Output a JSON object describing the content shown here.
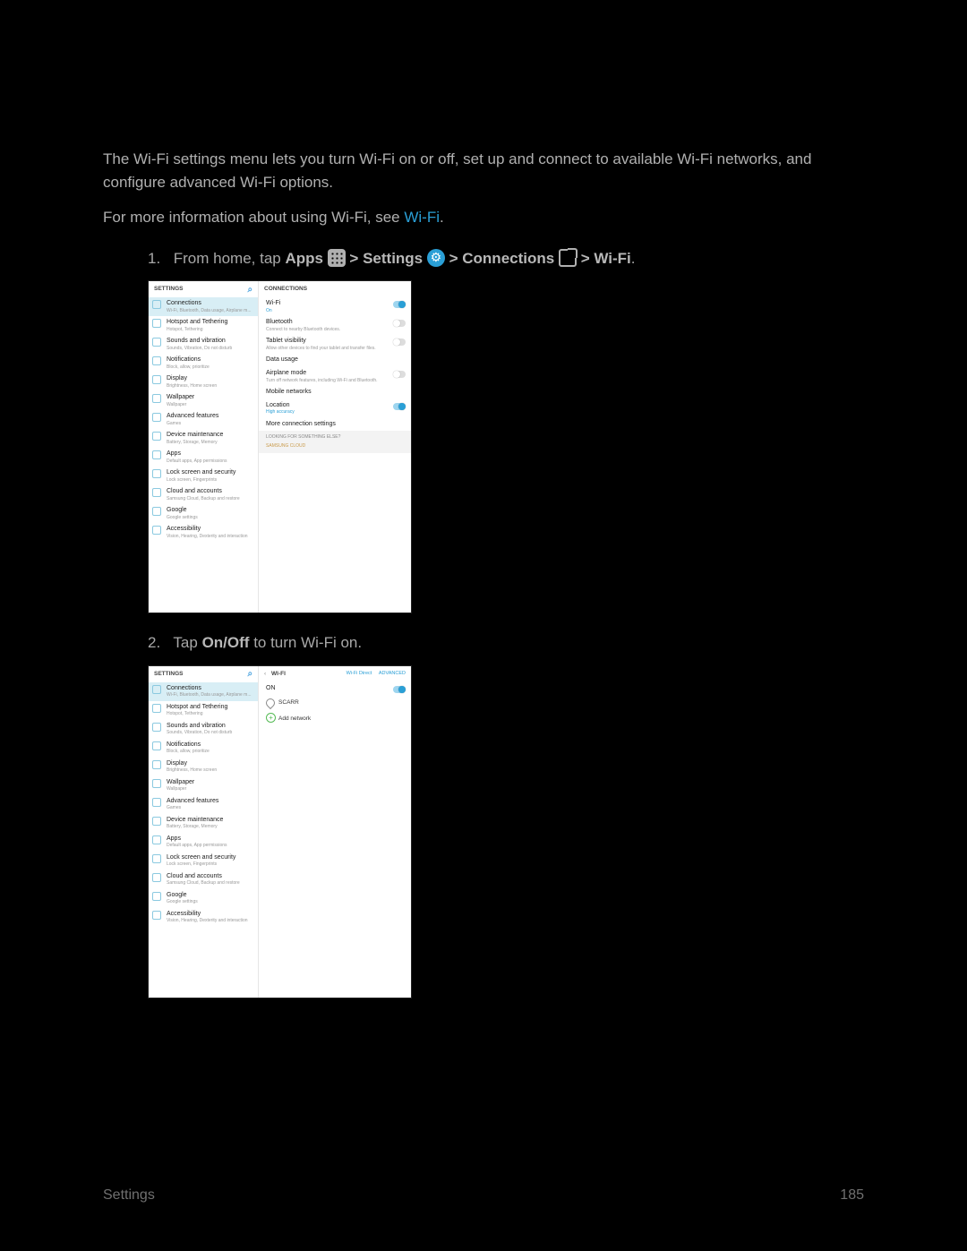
{
  "intro": "The Wi-Fi settings menu lets you turn Wi-Fi on or off, set up and connect to available Wi-Fi networks, and configure advanced Wi-Fi options.",
  "info_prefix": "For more information about using Wi-Fi, see ",
  "info_link": "Wi-Fi",
  "step1": {
    "num": "1.",
    "pre": "From home, tap ",
    "apps": "Apps",
    "gt1": " > ",
    "settings": "Settings",
    "gt2": " > ",
    "connections": "Connections",
    "gt3": " > ",
    "wifi": "Wi-Fi",
    "dot": "."
  },
  "step2": {
    "num": "2.",
    "pre": "Tap ",
    "onoff": "On/Off",
    "post": " to turn Wi-Fi on."
  },
  "mock": {
    "settings_hdr": "SETTINGS",
    "connections_hdr": "CONNECTIONS",
    "wifi_hdr": "WI-FI",
    "wifi_direct": "Wi-Fi Direct",
    "advanced": "ADVANCED",
    "on_label": "ON",
    "sidebar": [
      {
        "t": "Connections",
        "s": "Wi-Fi, Bluetooth, Data usage, Airplane m..."
      },
      {
        "t": "Hotspot and Tethering",
        "s": "Hotspot, Tethering"
      },
      {
        "t": "Sounds and vibration",
        "s": "Sounds, Vibration, Do not disturb"
      },
      {
        "t": "Notifications",
        "s": "Block, allow, prioritize"
      },
      {
        "t": "Display",
        "s": "Brightness, Home screen"
      },
      {
        "t": "Wallpaper",
        "s": "Wallpaper"
      },
      {
        "t": "Advanced features",
        "s": "Games"
      },
      {
        "t": "Device maintenance",
        "s": "Battery, Storage, Memory"
      },
      {
        "t": "Apps",
        "s": "Default apps, App permissions"
      },
      {
        "t": "Lock screen and security",
        "s": "Lock screen, Fingerprints"
      },
      {
        "t": "Cloud and accounts",
        "s": "Samsung Cloud, Backup and restore"
      },
      {
        "t": "Google",
        "s": "Google settings"
      },
      {
        "t": "Accessibility",
        "s": "Vision, Hearing, Dexterity and interaction"
      }
    ],
    "conn_rows": [
      {
        "t": "Wi-Fi",
        "s": "On",
        "son": true,
        "toggle": "on"
      },
      {
        "t": "Bluetooth",
        "s": "Connect to nearby Bluetooth devices.",
        "toggle": "off"
      },
      {
        "t": "Tablet visibility",
        "s": "Allow other devices to find your tablet and transfer files.",
        "toggle": "off"
      },
      {
        "t": "Data usage",
        "s": ""
      },
      {
        "t": "Airplane mode",
        "s": "Turn off network features, including Wi-Fi and Bluetooth.",
        "toggle": "off"
      },
      {
        "t": "Mobile networks",
        "s": ""
      },
      {
        "t": "Location",
        "s": "High accuracy",
        "son": true,
        "toggle": "on"
      },
      {
        "t": "More connection settings",
        "s": ""
      }
    ],
    "banner_t": "LOOKING FOR SOMETHING ELSE?",
    "banner_l": "SAMSUNG CLOUD",
    "network": "SCARR",
    "add_network": "Add network"
  },
  "footer": {
    "left": "Settings",
    "right": "185"
  }
}
